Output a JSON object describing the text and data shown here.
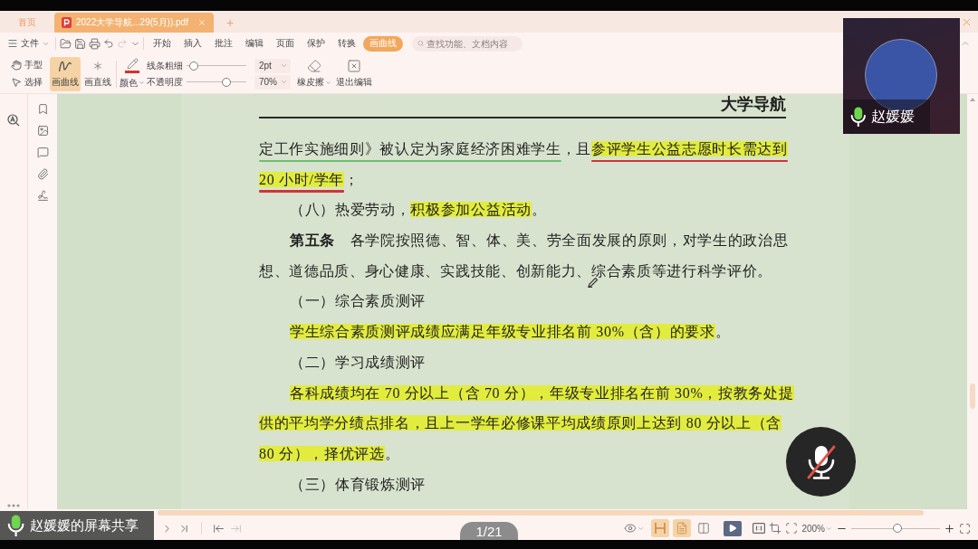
{
  "tabs": [
    {
      "kind": "home",
      "label": "首页",
      "selected": false
    },
    {
      "kind": "document",
      "label": "2022大学导航...29(5月)).pdf",
      "selected": true
    }
  ],
  "new_tab_label": "+",
  "menu": {
    "file_label": "文件",
    "tabs": [
      {
        "label": "开始",
        "selected": false
      },
      {
        "label": "插入",
        "selected": false
      },
      {
        "label": "批注",
        "selected": false
      },
      {
        "label": "编辑",
        "selected": false
      },
      {
        "label": "页面",
        "selected": false
      },
      {
        "label": "保护",
        "selected": false
      },
      {
        "label": "转换",
        "selected": false
      },
      {
        "label": "画曲线",
        "selected": true
      }
    ],
    "search": {
      "placeholder": "查找功能、文档内容"
    }
  },
  "toolbar": {
    "modes": [
      {
        "label": "手型",
        "selected": false
      },
      {
        "label": "选择",
        "selected": false
      }
    ],
    "draw_tools": [
      {
        "label": "画曲线",
        "selected": true
      },
      {
        "label": "画直线",
        "selected": false
      }
    ],
    "color": {
      "label": "颜色",
      "color": "#d8312c"
    },
    "line_width": {
      "label": "线条粗细",
      "level": 0.05,
      "value": "2pt"
    },
    "opacity": {
      "label": "不透明度",
      "level": 0.7,
      "value": "70%"
    },
    "eraser": {
      "label": "橡皮擦"
    },
    "exit": {
      "label": "退出编辑"
    }
  },
  "document": {
    "header": "大学导航",
    "lines": [
      {
        "kind": "continuation",
        "segments": [
          {
            "text": "定工作实施细则》被认定为家庭经济困难学生",
            "highlighted": false,
            "underline": {
              "color": "#6cc070"
            }
          },
          {
            "text": "，且",
            "highlighted": false
          },
          {
            "text": "参评学生公益志愿时长需达到",
            "highlighted": true,
            "underline": {
              "color": "#d2333a"
            }
          }
        ]
      },
      {
        "kind": "continuation",
        "segments": [
          {
            "text": "20 小时/学年",
            "highlighted": true,
            "underline": {
              "color": "#d2333a"
            }
          },
          {
            "text": "；",
            "highlighted": false
          }
        ]
      },
      {
        "kind": "paragraph-start",
        "segments": [
          {
            "text": "（八）热爱劳动，",
            "highlighted": false
          },
          {
            "text": "积极参加公益活动",
            "highlighted": true
          },
          {
            "text": "。",
            "highlighted": false
          }
        ]
      },
      {
        "kind": "paragraph-start",
        "segments": [
          {
            "text": "**第五条**　各学院按照德、智、体、美、劳全面发展的原则，对学生的政治思",
            "highlighted": false
          }
        ]
      },
      {
        "kind": "continuation",
        "segments": [
          {
            "text": "想、道德品质、身心健康、实践技能、创新能力、综合素质等进行科学评价。",
            "highlighted": false
          }
        ]
      },
      {
        "kind": "paragraph-start",
        "segments": [
          {
            "text": "（一）综合素质测评",
            "highlighted": false
          }
        ]
      },
      {
        "kind": "paragraph-start",
        "segments": [
          {
            "text": "学生综合素质测评成绩应满足年级专业排名前 30%（含）的要求",
            "highlighted": true
          },
          {
            "text": "。",
            "highlighted": false
          }
        ]
      },
      {
        "kind": "paragraph-start",
        "segments": [
          {
            "text": "（二）学习成绩测评",
            "highlighted": false
          }
        ]
      },
      {
        "kind": "paragraph-start",
        "segments": [
          {
            "text": "各科成绩均在 70 分以上（含 70 分），年级专业排名在前 30%，按教务处提",
            "highlighted": true
          }
        ]
      },
      {
        "kind": "continuation",
        "segments": [
          {
            "text": "供的平均学分绩点排名，且上一学年必修课平均成绩原则上达到 80 分以上（含",
            "highlighted": true
          }
        ]
      },
      {
        "kind": "continuation",
        "segments": [
          {
            "text": "80 分），择优评选",
            "highlighted": true
          },
          {
            "text": "。",
            "highlighted": false
          }
        ]
      },
      {
        "kind": "paragraph-start",
        "segments": [
          {
            "text": "（三）体育锻炼测评",
            "highlighted": false
          }
        ]
      }
    ]
  },
  "status_bar": {
    "view_modes": [
      {
        "selected": true
      },
      {
        "selected": true
      },
      {
        "selected": false
      }
    ],
    "zoom": "200%",
    "zoom_slider": {
      "level": 0.52
    }
  },
  "overlays": {
    "screen_share": {
      "label": "赵媛媛的屏幕共享"
    },
    "page_indicator": "1/21",
    "video_tile": {
      "name": "赵媛媛"
    },
    "mic_button": {
      "muted": true
    }
  }
}
